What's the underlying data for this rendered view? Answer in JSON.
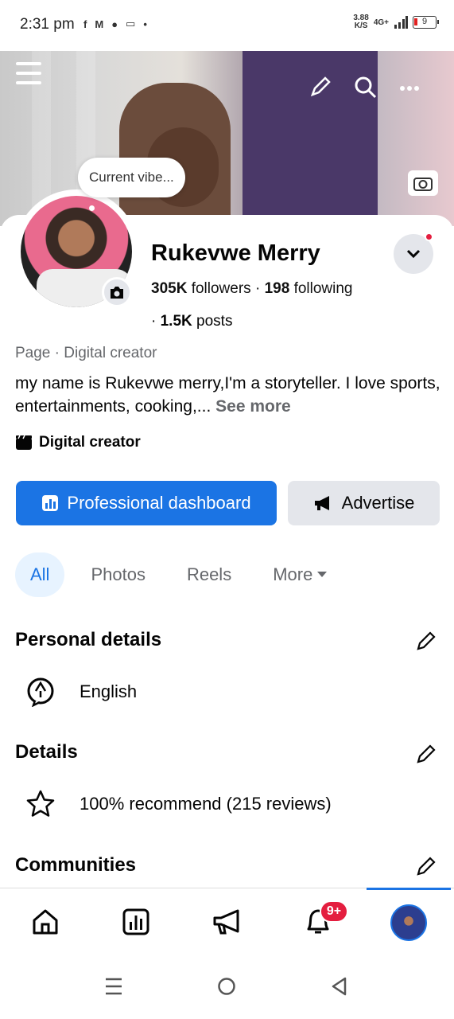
{
  "status_bar": {
    "time": "2:31 pm",
    "speed_value": "3.88",
    "speed_unit": "K/S",
    "network": "4G+",
    "battery": "9"
  },
  "cover": {
    "current_vibe": "Current vibe..."
  },
  "profile": {
    "name": "Rukevwe Merry",
    "followers_count": "305K",
    "followers_label": "followers",
    "separator": "·",
    "following_count": "198",
    "following_label": "following",
    "posts_prefix": "·",
    "posts_count": "1.5K",
    "posts_label": "posts",
    "page_type": "Page · Digital creator",
    "bio": "my name is Rukevwe merry,I'm a storyteller. I love sports, entertainments, cooking,...",
    "see_more": "See more",
    "category": "Digital creator"
  },
  "actions": {
    "dashboard_label": "Professional dashboard",
    "advertise_label": "Advertise"
  },
  "tabs": [
    {
      "label": "All",
      "active": true
    },
    {
      "label": "Photos",
      "active": false
    },
    {
      "label": "Reels",
      "active": false
    },
    {
      "label": "More",
      "active": false
    }
  ],
  "sections": {
    "personal_details": {
      "title": "Personal details",
      "language": "English"
    },
    "details": {
      "title": "Details",
      "recommend": "100% recommend (215 reviews)"
    },
    "communities": {
      "title": "Communities"
    }
  },
  "bottom_nav": {
    "notification_badge": "9+"
  },
  "colors": {
    "accent": "#1b74e4",
    "badge": "#e41e3f",
    "secondary_bg": "#e4e6eb",
    "muted_text": "#65676b"
  }
}
